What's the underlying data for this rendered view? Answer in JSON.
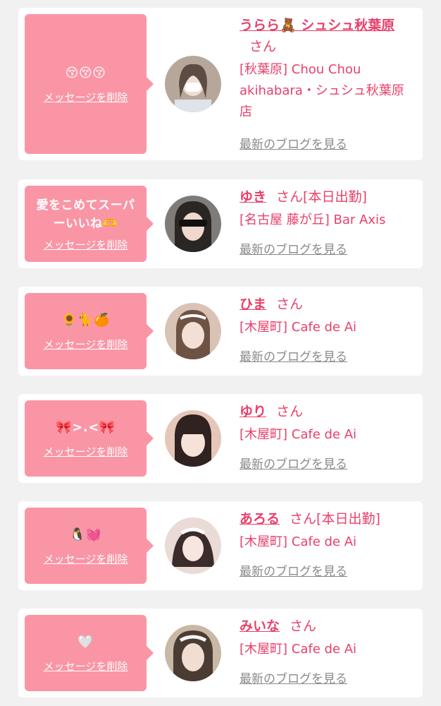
{
  "cards": [
    {
      "message": "😚😚😚",
      "delete_label": "メッセージを削除",
      "name": "うらら🧸 シュシュ秋葉原",
      "san": "さん",
      "status": "",
      "shop": "[秋葉原] Chou Chou akihabara・シュシュ秋葉原店",
      "blog_label": "最新のブログを見る",
      "avatar_colors": [
        "#b7a79a",
        "#5b4d44"
      ]
    },
    {
      "message": "愛をこめてスーパーいいね🫶",
      "delete_label": "メッセージを削除",
      "name": "ゆき",
      "san": "さん",
      "status": "[本日出勤]",
      "shop": "[名古屋 藤が丘] Bar Axis",
      "blog_label": "最新のブログを見る",
      "avatar_colors": [
        "#7e7b79",
        "#2a2624"
      ]
    },
    {
      "message": "🌻🐈🍊",
      "delete_label": "メッセージを削除",
      "name": "ひま",
      "san": "さん",
      "status": "",
      "shop": "[木屋町] Cafe de Ai",
      "blog_label": "最新のブログを見る",
      "avatar_colors": [
        "#d9c3b4",
        "#6e5244"
      ]
    },
    {
      "message": "🎀>.<🎀",
      "delete_label": "メッセージを削除",
      "name": "ゆり",
      "san": "さん",
      "status": "",
      "shop": "[木屋町] Cafe de Ai",
      "blog_label": "最新のブログを見る",
      "avatar_colors": [
        "#e6c6b8",
        "#2f2220"
      ]
    },
    {
      "message": "🐧💓",
      "delete_label": "メッセージを削除",
      "name": "あろる",
      "san": "さん",
      "status": "[本日出勤]",
      "shop": "[木屋町] Cafe de Ai",
      "blog_label": "最新のブログを見る",
      "avatar_colors": [
        "#eadbd6",
        "#3b2b2b"
      ]
    },
    {
      "message": "🤍",
      "delete_label": "メッセージを削除",
      "name": "みいな",
      "san": "さん",
      "status": "",
      "shop": "[木屋町] Cafe de Ai",
      "blog_label": "最新のブログを見る",
      "avatar_colors": [
        "#c9b8a5",
        "#4a3b33"
      ]
    }
  ]
}
